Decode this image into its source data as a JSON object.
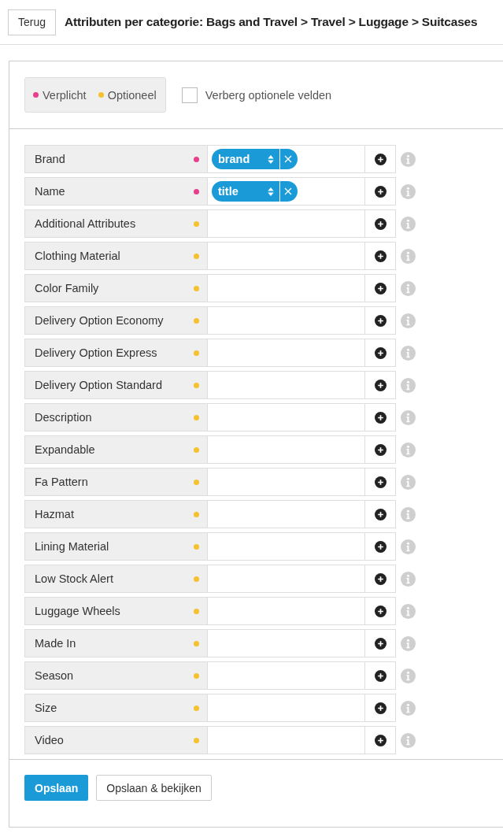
{
  "header": {
    "back_button": "Terug",
    "title": "Attributen per categorie: Bags and Travel > Travel > Luggage > Suitcases"
  },
  "legend": [
    {
      "label": "Verplicht",
      "kind": "required"
    },
    {
      "label": "Optioneel",
      "kind": "optional"
    }
  ],
  "hide_optional": {
    "label": "Verberg optionele velden",
    "checked": false
  },
  "attributes": [
    {
      "name": "Brand",
      "required": true,
      "mapping": "brand"
    },
    {
      "name": "Name",
      "required": true,
      "mapping": "title"
    },
    {
      "name": "Additional Attributes",
      "required": false
    },
    {
      "name": "Clothing Material",
      "required": false
    },
    {
      "name": "Color Family",
      "required": false
    },
    {
      "name": "Delivery Option Economy",
      "required": false
    },
    {
      "name": "Delivery Option Express",
      "required": false
    },
    {
      "name": "Delivery Option Standard",
      "required": false
    },
    {
      "name": "Description",
      "required": false
    },
    {
      "name": "Expandable",
      "required": false
    },
    {
      "name": "Fa Pattern",
      "required": false
    },
    {
      "name": "Hazmat",
      "required": false
    },
    {
      "name": "Lining Material",
      "required": false
    },
    {
      "name": "Low Stock Alert",
      "required": false
    },
    {
      "name": "Luggage Wheels",
      "required": false
    },
    {
      "name": "Made In",
      "required": false
    },
    {
      "name": "Season",
      "required": false
    },
    {
      "name": "Size",
      "required": false
    },
    {
      "name": "Video",
      "required": false
    }
  ],
  "footer": {
    "save_button": "Opslaan",
    "save_view_button": "Opslaan & bekijken"
  }
}
